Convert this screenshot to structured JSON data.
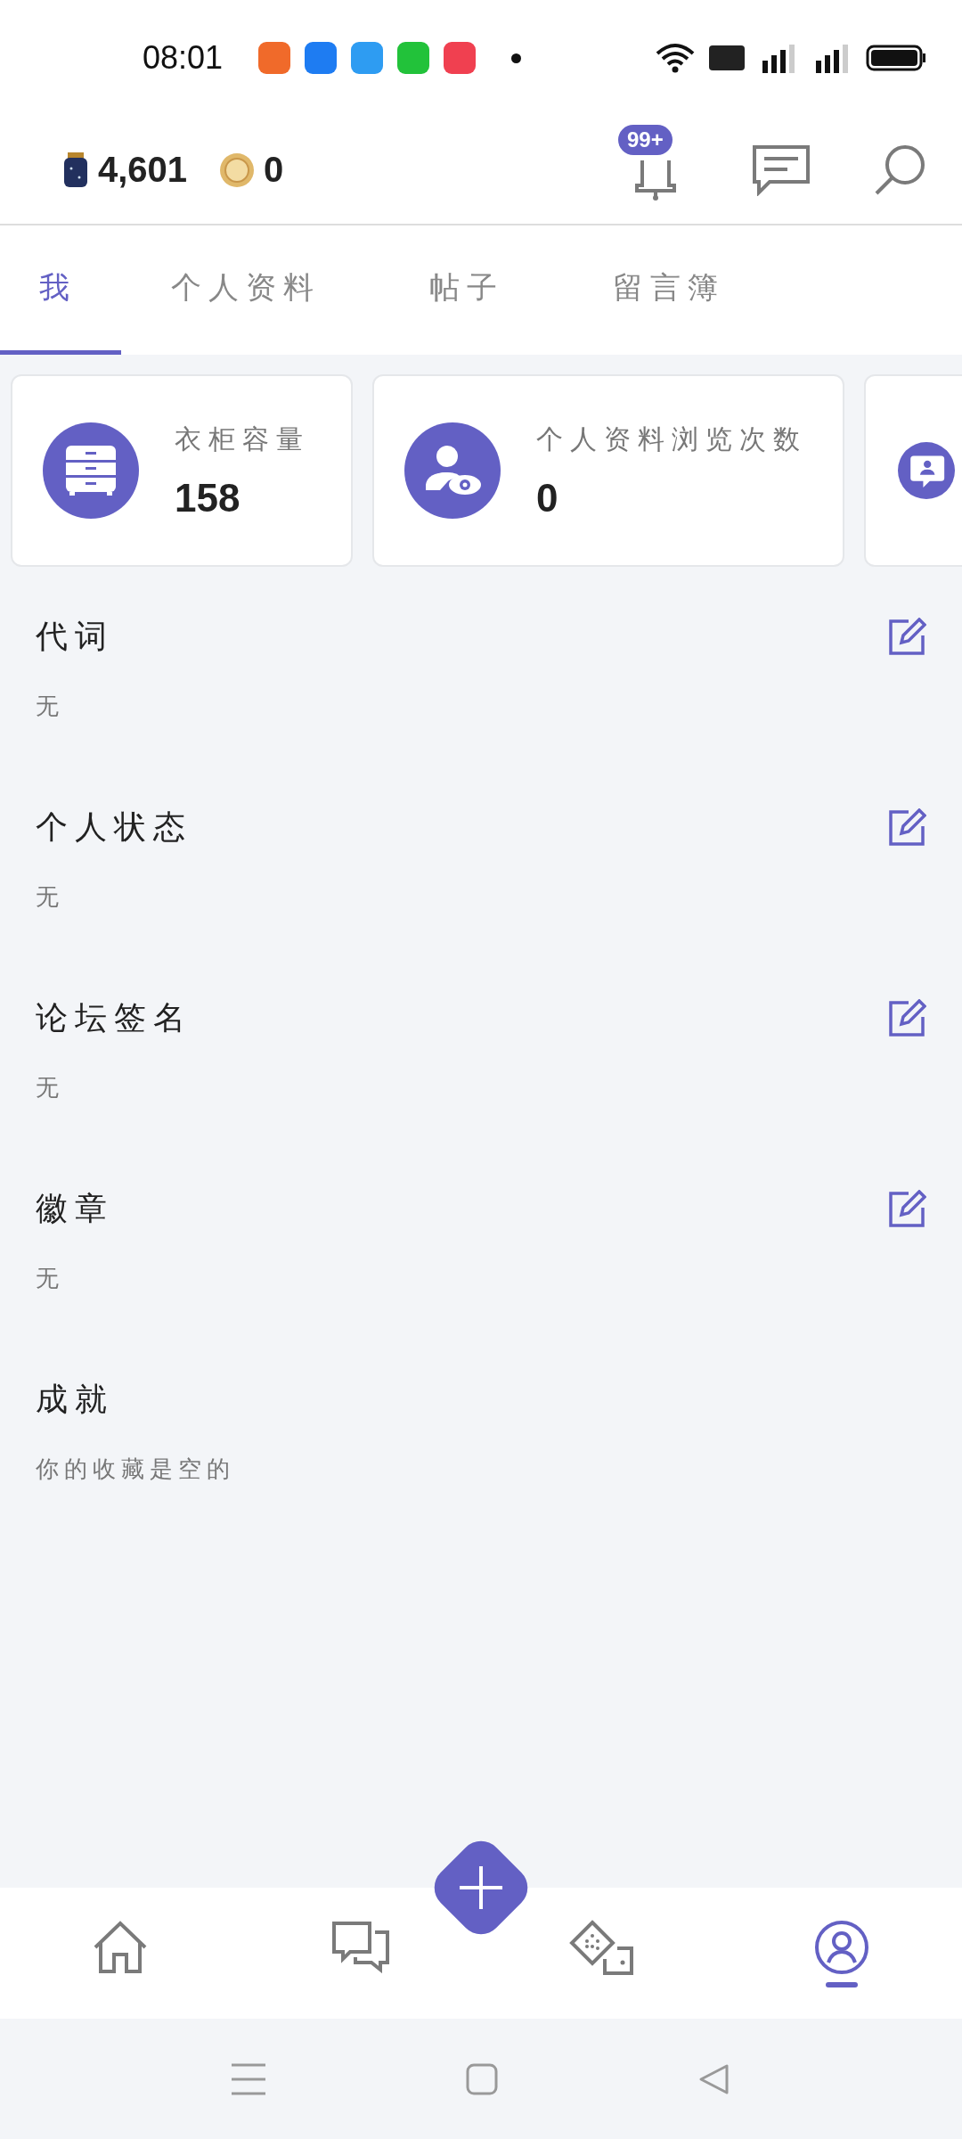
{
  "status_bar": {
    "time": "08:01"
  },
  "header": {
    "balances": [
      {
        "kind": "jar",
        "value": "4,601"
      },
      {
        "kind": "coin",
        "value": "0"
      }
    ],
    "notification_badge": "99+"
  },
  "tabs": [
    {
      "label": "我",
      "selected": true
    },
    {
      "label": "个人资料",
      "selected": false
    },
    {
      "label": "帖子",
      "selected": false
    },
    {
      "label": "留言簿",
      "selected": false
    }
  ],
  "stat_cards": [
    {
      "kind": "wardrobe",
      "label": "衣柜容量",
      "value": "158"
    },
    {
      "kind": "views",
      "label": "个人资料浏览次数",
      "value": "0"
    },
    {
      "kind": "message"
    }
  ],
  "sections": [
    {
      "title": "代词",
      "value": "无",
      "editable": true
    },
    {
      "title": "个人状态",
      "value": "无",
      "editable": true
    },
    {
      "title": "论坛签名",
      "value": "无",
      "editable": true
    },
    {
      "title": "徽章",
      "value": "无",
      "editable": true
    },
    {
      "title": "成就",
      "value": "你的收藏是空的",
      "editable": false
    }
  ],
  "bottom_nav": [
    {
      "kind": "home",
      "selected": false
    },
    {
      "kind": "chat",
      "selected": false
    },
    {
      "kind": "dice",
      "selected": false
    },
    {
      "kind": "profile",
      "selected": true
    }
  ]
}
